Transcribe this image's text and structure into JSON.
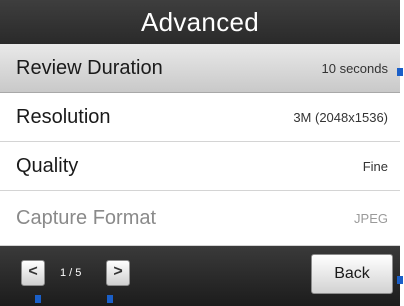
{
  "header": {
    "title": "Advanced"
  },
  "settings": [
    {
      "label": "Review Duration",
      "value": "10 seconds"
    },
    {
      "label": "Resolution",
      "value": "3M (2048x1536)"
    },
    {
      "label": "Quality",
      "value": "Fine"
    },
    {
      "label": "Capture Format",
      "value": "JPEG"
    }
  ],
  "footer": {
    "prev_label": "<",
    "page_indicator": "1 / 5",
    "next_label": ">",
    "back_label": "Back"
  },
  "colors": {
    "header_bg": "#333333",
    "selected_row_bg": "#d9d9d9",
    "footer_bg": "#2a2a2a",
    "marker": "#1a5fc8"
  }
}
